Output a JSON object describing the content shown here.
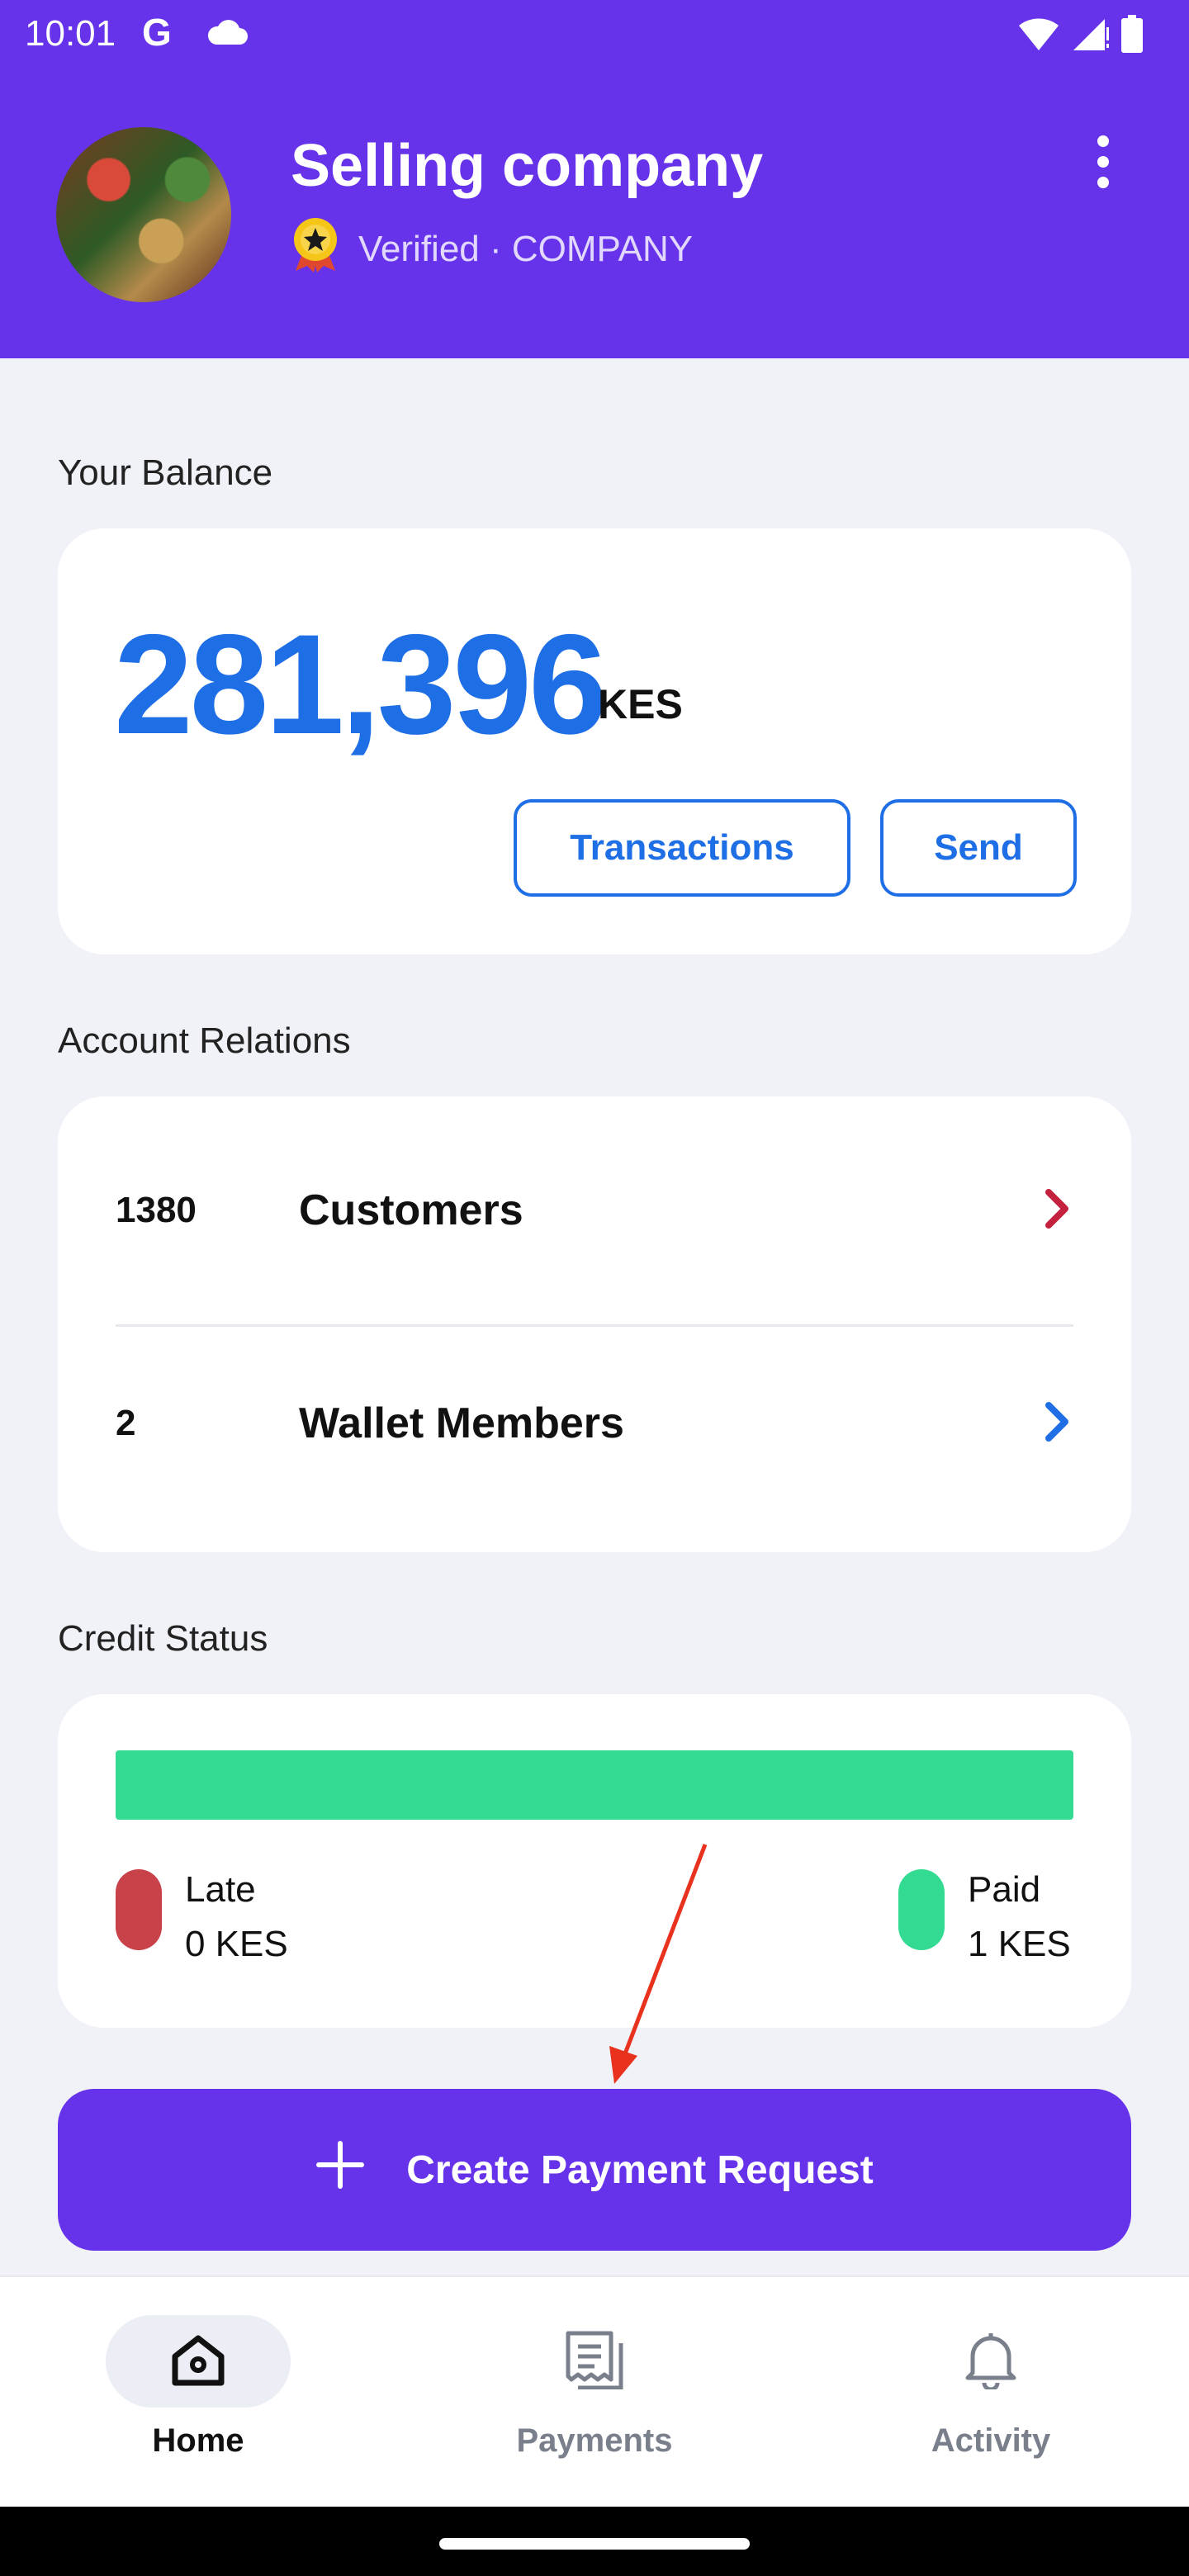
{
  "status_bar": {
    "time": "10:01",
    "g_glyph": "G",
    "icons": [
      "cloud-icon",
      "wifi-icon",
      "signal-icon",
      "battery-icon"
    ]
  },
  "header": {
    "company_name": "Selling company",
    "verified_text": "Verified · COMPANY",
    "badge_icon": "verified-badge-icon",
    "menu_icon": "more-vert-icon"
  },
  "balance": {
    "section_label": "Your Balance",
    "amount": "281,396",
    "currency": "KES",
    "transactions_label": "Transactions",
    "send_label": "Send"
  },
  "relations": {
    "section_label": "Account Relations",
    "items": [
      {
        "count": "1380",
        "label": "Customers",
        "chevron_color": "#c4213f"
      },
      {
        "count": "2",
        "label": "Wallet Members",
        "chevron_color": "#1e6ee6"
      }
    ]
  },
  "credit": {
    "section_label": "Credit Status",
    "paid_fraction": 1.0,
    "late": {
      "label": "Late",
      "amount": "0 KES",
      "color": "#c9424a"
    },
    "paid": {
      "label": "Paid",
      "amount": "1 KES",
      "color": "#32da92"
    }
  },
  "cta": {
    "label": "Create Payment Request",
    "icon": "plus-icon"
  },
  "nav": {
    "items": [
      {
        "label": "Home",
        "icon": "home-icon",
        "active": true
      },
      {
        "label": "Payments",
        "icon": "receipt-icon",
        "active": false
      },
      {
        "label": "Activity",
        "icon": "bell-icon",
        "active": false
      }
    ]
  },
  "colors": {
    "primary": "#6633ea",
    "accent_blue": "#1e6ee6",
    "paid_green": "#32da92",
    "late_red": "#c9424a",
    "annotation_arrow": "#e8321e"
  }
}
